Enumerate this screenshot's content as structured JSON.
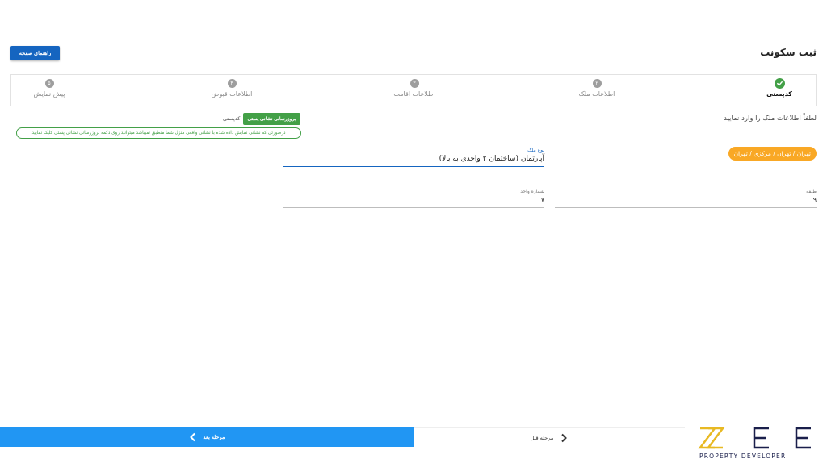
{
  "header": {
    "title": "ثبت سکونت",
    "guide_button": "راهنمای صفحه"
  },
  "stepper": {
    "steps": [
      {
        "label": "کدپستی",
        "marker": "",
        "state": "done"
      },
      {
        "label": "اطلاعات ملک",
        "marker": "۲",
        "state": "pending"
      },
      {
        "label": "اطلاعات اقامت",
        "marker": "۳",
        "state": "pending"
      },
      {
        "label": "اطلاعات قبوض",
        "marker": "۴",
        "state": "pending"
      },
      {
        "label": "پیش نمایش",
        "marker": "۵",
        "state": "pending"
      }
    ]
  },
  "form": {
    "instruction": "لطفاً اطلاعات ملک را وارد نمایید",
    "postal_code_label": "کدپستی",
    "update_address_button": "بروزرسانی نشانی پستی",
    "notice": "درصورتی که نشانی نمایش داده شده با نشانی واقعی منزل شما منطبق نمیباشد میتوانید روی دکمه بروزرسانی نشانی پستی کلیک نمایید",
    "location": "تهران / تهران / مرکزی / تهران",
    "property_type": {
      "label": "نوع ملک",
      "value": "آپارتمان (ساختمان ۲ واحدی به بالا)"
    },
    "floor": {
      "label": "طبقه",
      "value": "۹"
    },
    "unit_number": {
      "label": "شماره واحد",
      "value": "۷"
    }
  },
  "footer": {
    "next_button": "مرحله بعد",
    "prev_button": "مرحله قبل"
  },
  "logo": {
    "tagline": "PROPERTY DEVELOPER",
    "accent_color": "#e8b923",
    "primary_color": "#1a1f4b"
  },
  "colors": {
    "primary": "#1565c0",
    "next": "#2196f3",
    "success": "#43a047",
    "chip": "#f9a825"
  }
}
